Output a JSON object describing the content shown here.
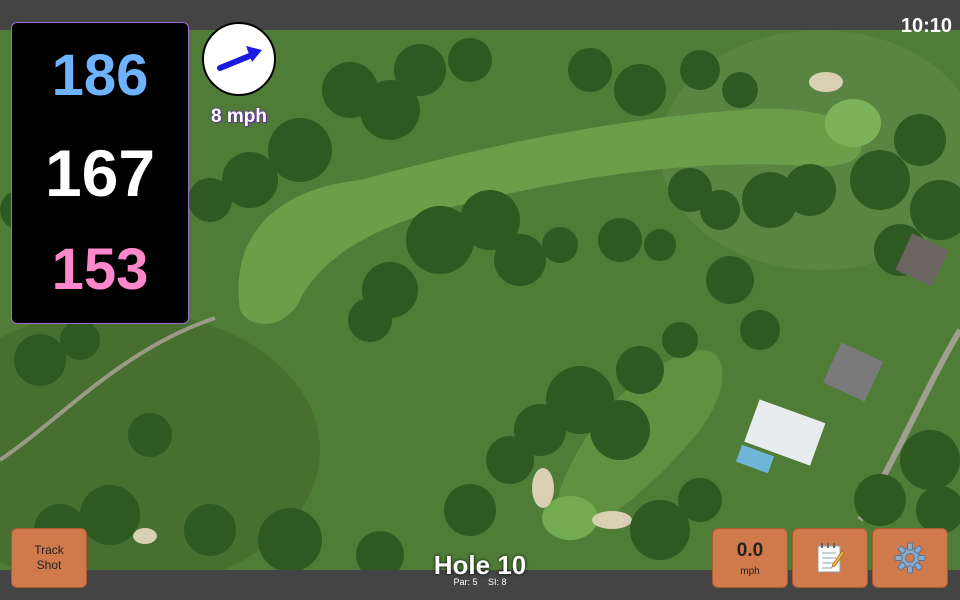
{
  "status_bar": {
    "time": "10:10"
  },
  "distances": {
    "back": "186",
    "middle": "167",
    "front": "153"
  },
  "wind": {
    "speed_label": "8 mph",
    "direction_icon": "arrow-icon"
  },
  "hole": {
    "title": "Hole 10",
    "par_label": "Par: 5",
    "si_label": "SI: 8"
  },
  "buttons": {
    "track_shot_line1": "Track",
    "track_shot_line2": "Shot",
    "speed_value": "0.0",
    "speed_unit": "mph",
    "notes_icon": "notepad-icon",
    "settings_icon": "gear-icon"
  },
  "colors": {
    "back_distance": "#6fb2ff",
    "middle_distance": "#ffffff",
    "front_distance": "#ff88cc",
    "button_bg": "#d07a4c",
    "wind_arrow": "#1a1ae0"
  }
}
